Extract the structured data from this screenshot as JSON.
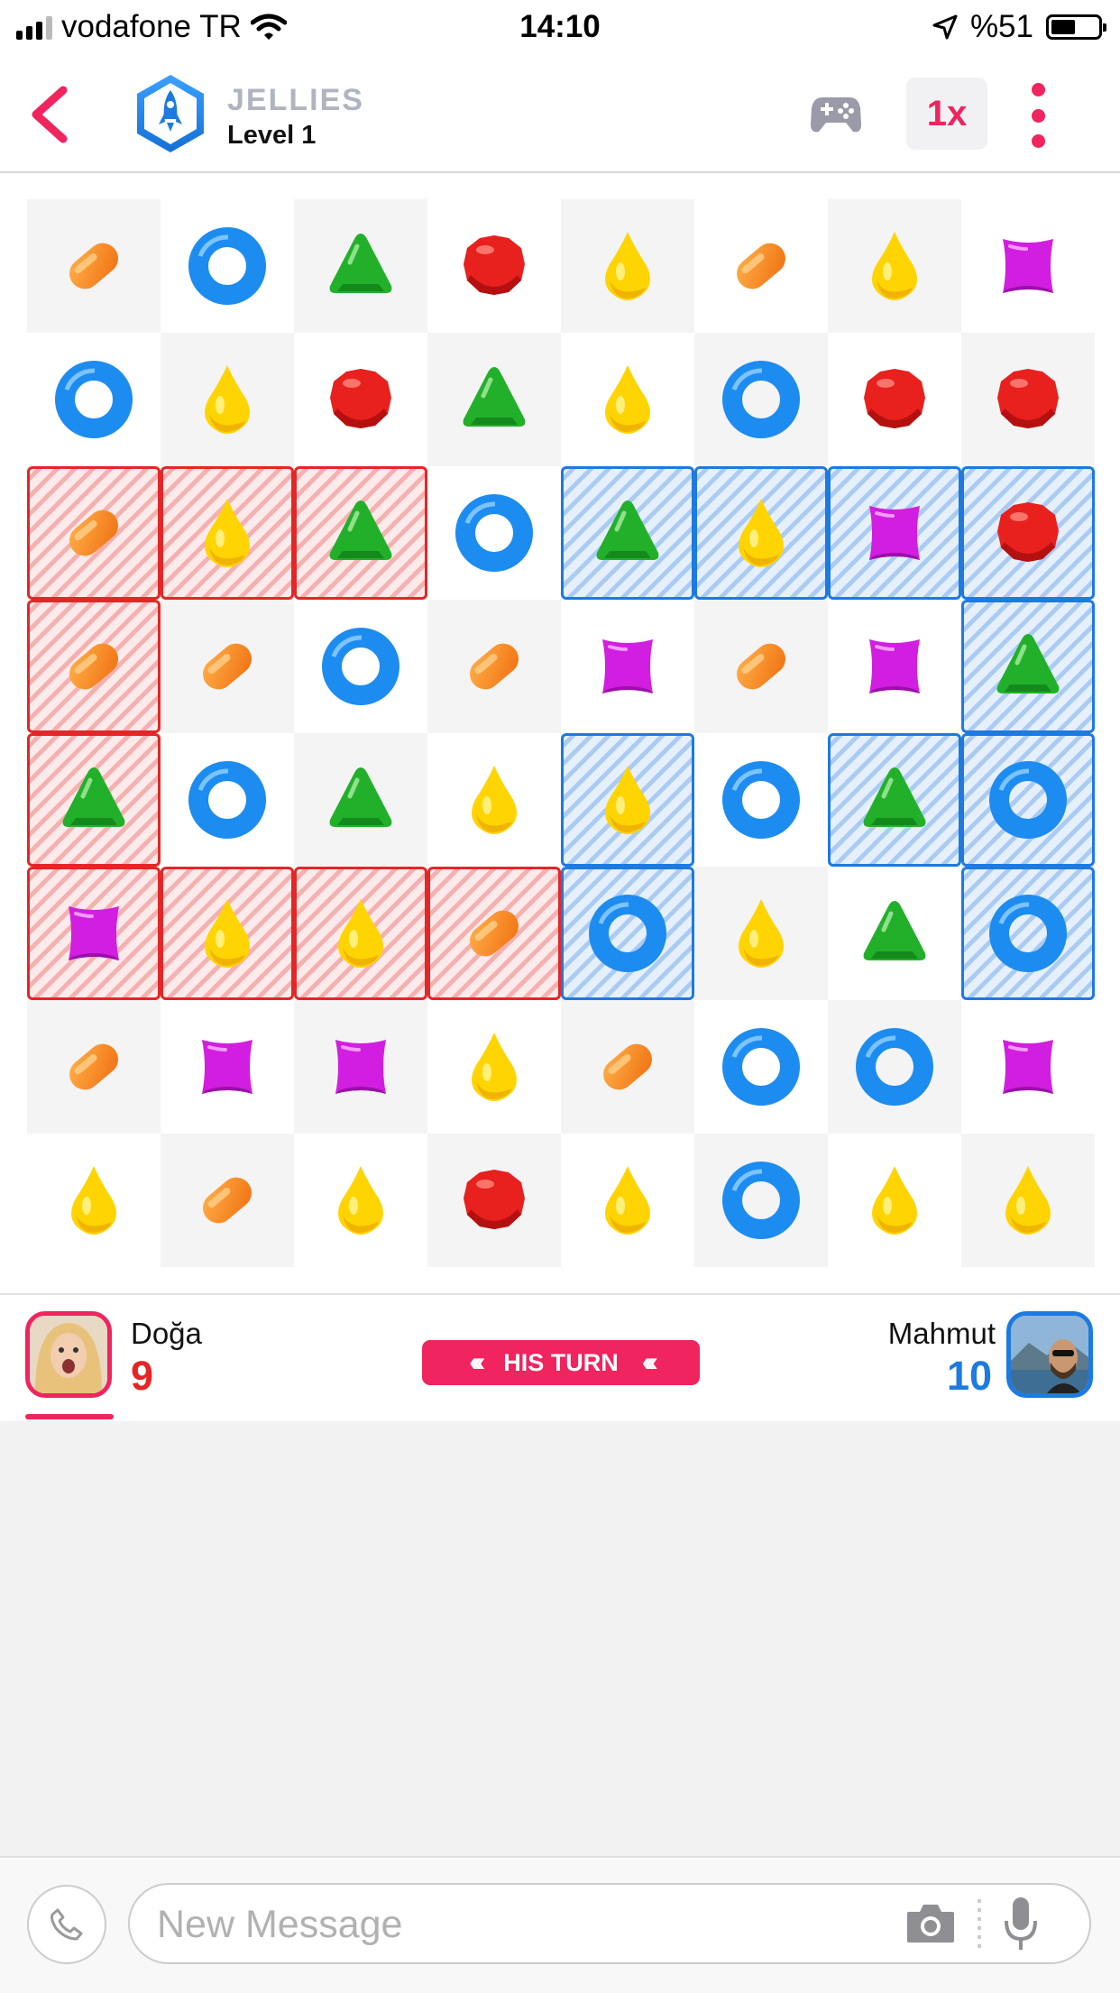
{
  "status_bar": {
    "carrier": "vodafone TR",
    "time": "14:10",
    "battery_text": "%51",
    "battery_level": 0.51
  },
  "header": {
    "game_title": "JELLIES",
    "level": "Level 1",
    "speed_label": "1x"
  },
  "board": {
    "rows": [
      [
        "orange",
        "blue",
        "green",
        "red",
        "yellow",
        "orange",
        "yellow",
        "purple"
      ],
      [
        "blue",
        "yellow",
        "red",
        "green",
        "yellow",
        "blue",
        "red",
        "red"
      ],
      [
        "orange",
        "yellow",
        "green",
        "blue",
        "green",
        "yellow",
        "purple",
        "red"
      ],
      [
        "orange",
        "orange",
        "blue",
        "orange",
        "purple",
        "orange",
        "purple",
        "green"
      ],
      [
        "green",
        "blue",
        "green",
        "yellow",
        "yellow",
        "blue",
        "green",
        "blue"
      ],
      [
        "purple",
        "yellow",
        "yellow",
        "orange",
        "blue",
        "yellow",
        "green",
        "blue"
      ],
      [
        "orange",
        "purple",
        "purple",
        "yellow",
        "orange",
        "blue",
        "blue",
        "purple"
      ],
      [
        "yellow",
        "orange",
        "yellow",
        "red",
        "yellow",
        "blue",
        "yellow",
        "yellow"
      ]
    ],
    "territory": [
      [
        "",
        "",
        "",
        "",
        "",
        "",
        "",
        ""
      ],
      [
        "",
        "",
        "",
        "",
        "",
        "",
        "",
        ""
      ],
      [
        "red",
        "red",
        "red",
        "",
        "blue",
        "blue",
        "blue",
        "blue"
      ],
      [
        "red",
        "",
        "",
        "",
        "",
        "",
        "",
        "blue"
      ],
      [
        "red",
        "",
        "",
        "",
        "blue",
        "",
        "blue",
        "blue"
      ],
      [
        "red",
        "red",
        "red",
        "red",
        "blue",
        "",
        "",
        "blue"
      ],
      [
        "",
        "",
        "",
        "",
        "",
        "",
        "",
        ""
      ],
      [
        "",
        "",
        "",
        "",
        "",
        "",
        "",
        ""
      ]
    ]
  },
  "players": {
    "left": {
      "name": "Doğa",
      "score": "9",
      "color": "#e52626"
    },
    "right": {
      "name": "Mahmut",
      "score": "10",
      "color": "#1d7ae0"
    },
    "turn_label": "HIS TURN",
    "turn_arrows": "‹‹‹"
  },
  "message": {
    "placeholder": "New Message"
  },
  "colors": {
    "accent": "#f0245e",
    "red_team": "#e52626",
    "blue_team": "#1d7ae0"
  }
}
